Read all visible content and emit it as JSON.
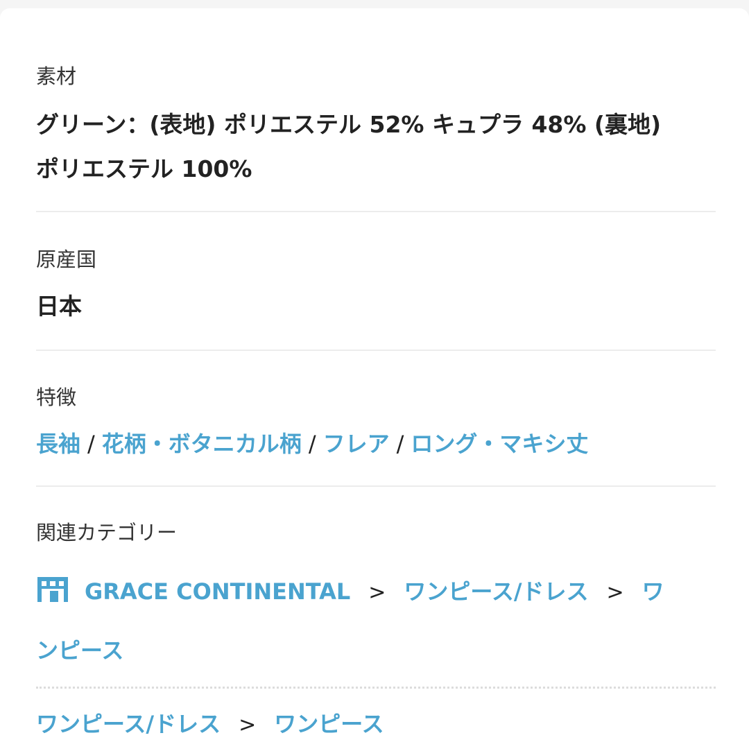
{
  "material": {
    "label": "素材",
    "line1": "グリーン：(表地) ポリエステル 52% キュプラ 48% (裏地)",
    "line2": "ポリエステル 100%"
  },
  "origin": {
    "label": "原産国",
    "value": "日本"
  },
  "features": {
    "label": "特徴",
    "items": [
      "長袖",
      "花柄・ボタニカル柄",
      "フレア",
      "ロング・マキシ丈"
    ],
    "separator": "/"
  },
  "related": {
    "label": "関連カテゴリー",
    "path1": {
      "brand": "GRACE CONTINENTAL",
      "level1": "ワンピース/ドレス",
      "level2_part1": "ワ",
      "level2_part2": "ンピース"
    },
    "path2": {
      "level1": "ワンピース/ドレス",
      "level2": "ワンピース"
    },
    "arrow": ">"
  },
  "colors": {
    "link": "#4aa3cf",
    "text": "#222222",
    "label": "#333333",
    "divider": "#ececec"
  },
  "icons": {
    "shop": "shop-icon"
  }
}
